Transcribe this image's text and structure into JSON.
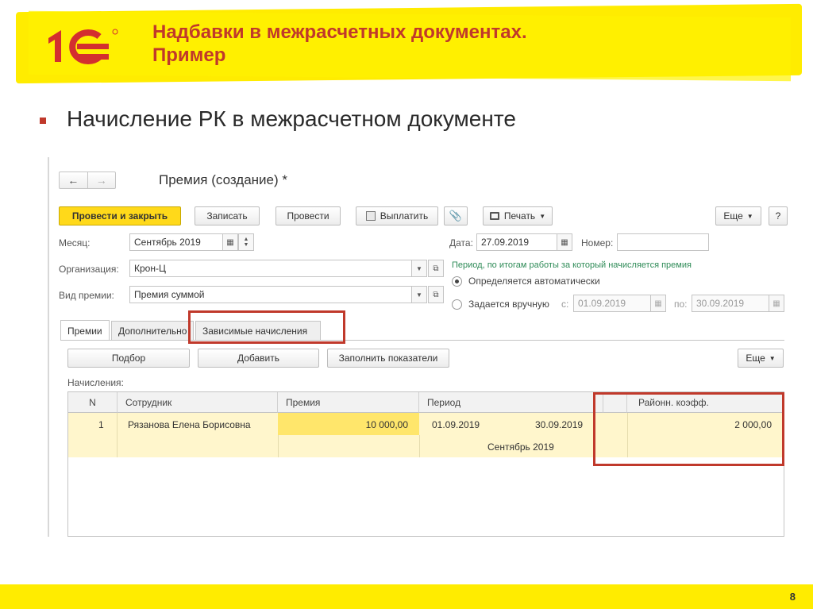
{
  "slide": {
    "title_line1": "Надбавки в межрасчетных документах.",
    "title_line2": "Пример",
    "bullet": "Начисление РК в межрасчетном документе",
    "page_number": "8",
    "colors": {
      "banner": "#ffec00",
      "accent_red": "#c0392b",
      "primary_button": "#ffd91a",
      "selected_row": "#fff6cc"
    }
  },
  "window": {
    "nav_back": "←",
    "nav_forward": "→",
    "title": "Премия (создание) *"
  },
  "toolbar": {
    "post_close": "Провести и закрыть",
    "save": "Записать",
    "post": "Провести",
    "pay": "Выплатить",
    "print": "Печать",
    "more": "Еще",
    "help": "?"
  },
  "form": {
    "month_label": "Месяц:",
    "month_value": "Сентябрь 2019",
    "date_label": "Дата:",
    "date_value": "27.09.2019",
    "number_label": "Номер:",
    "number_value": "",
    "org_label": "Организация:",
    "org_value": "Крон-Ц",
    "bonus_type_label": "Вид премии:",
    "bonus_type_value": "Премия суммой",
    "period_caption": "Период, по итогам работы за который начисляется премия",
    "radio_auto": "Определяется автоматически",
    "radio_manual": "Задается вручную",
    "from_label": "с:",
    "from_value": "01.09.2019",
    "to_label": "по:",
    "to_value": "30.09.2019"
  },
  "tabs": [
    "Премии",
    "Дополнительно",
    "Зависимые начисления"
  ],
  "table_toolbar": {
    "pick": "Подбор",
    "add": "Добавить",
    "fill": "Заполнить показатели",
    "more": "Еще"
  },
  "accruals_label": "Начисления:",
  "table": {
    "columns": [
      "N",
      "Сотрудник",
      "Премия",
      "Период",
      "",
      "Районн. коэфф."
    ],
    "rows": [
      {
        "n": "1",
        "employee": "Рязанова Елена Борисовна",
        "bonus": "10 000,00",
        "period_from": "01.09.2019",
        "period_to": "30.09.2019",
        "period_month": "Сентябрь 2019",
        "regional_coef": "2 000,00"
      }
    ]
  }
}
